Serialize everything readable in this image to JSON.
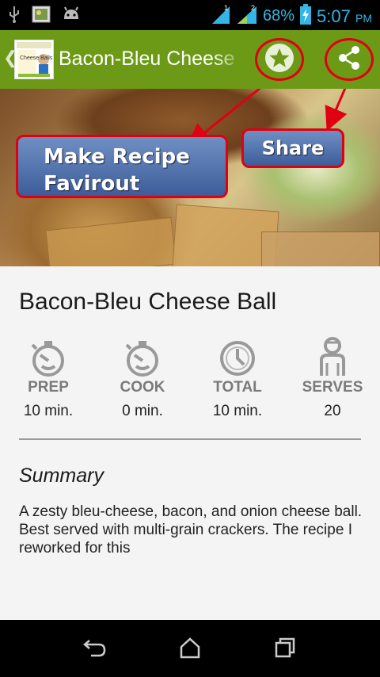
{
  "status_bar": {
    "icons": [
      "usb-icon",
      "picture-icon",
      "android-icon",
      "signal-1-icon",
      "signal-2-icon",
      "battery-charging-icon"
    ],
    "signal_1_label": "1",
    "signal_2_label": "2",
    "battery_percent": "68%",
    "time": "5:07",
    "ampm": "PM"
  },
  "action_bar": {
    "title": "Bacon-Bleu Cheese Ball",
    "app_icon_text": "Cheese Balls",
    "actions": [
      "star-icon",
      "share-icon"
    ],
    "color": "#6c9a16"
  },
  "hero": {
    "callout_favorite": "Make Recipe Favirout",
    "callout_share": "Share",
    "annotation_color": "#e00012"
  },
  "recipe": {
    "title": "Bacon-Bleu Cheese Ball",
    "stats": [
      {
        "icon": "timer-icon",
        "label": "PREP",
        "value": "10 min."
      },
      {
        "icon": "timer-icon",
        "label": "COOK",
        "value": "0 min."
      },
      {
        "icon": "clock-icon",
        "label": "TOTAL",
        "value": "10 min."
      },
      {
        "icon": "person-icon",
        "label": "SERVES",
        "value": "20"
      }
    ],
    "summary_heading": "Summary",
    "summary_text": "A zesty bleu-cheese, bacon, and onion cheese ball. Best served with multi-grain crackers. The recipe I reworked for this"
  },
  "nav_bar": {
    "buttons": [
      "back-icon",
      "home-icon",
      "recents-icon"
    ]
  }
}
